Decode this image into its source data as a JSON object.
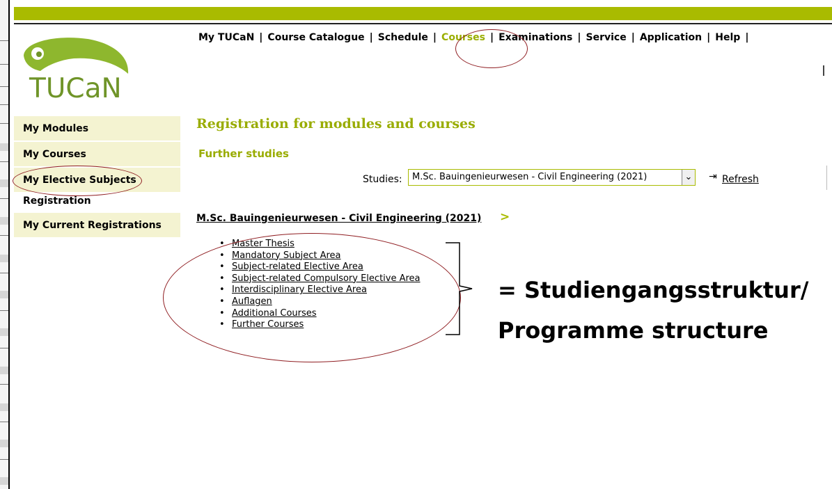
{
  "brand": {
    "logo_text": "TUCaN",
    "logo_icon": "toucan-logo-icon",
    "accent_color": "#a9bb00",
    "logo_color": "#6f9428",
    "highlight_circle_color": "#8f1d21"
  },
  "nav": {
    "items": [
      {
        "label": "My TUCaN"
      },
      {
        "label": "Course Catalogue"
      },
      {
        "label": "Schedule"
      },
      {
        "label": "Courses",
        "active": true
      },
      {
        "label": "Examinations"
      },
      {
        "label": "Service"
      },
      {
        "label": "Application"
      },
      {
        "label": "Help"
      }
    ],
    "separator": "|"
  },
  "sidebar": {
    "items": [
      {
        "label": "My Modules"
      },
      {
        "label": "My Courses"
      },
      {
        "label": "My Elective Subjects"
      },
      {
        "label": "Registration",
        "active": true
      },
      {
        "label": "My Current Registrations"
      }
    ]
  },
  "main": {
    "title": "Registration for modules and courses",
    "subtitle": "Further studies",
    "studies_label": "Studies:",
    "studies_selected": "M.Sc. Bauingenieurwesen - Civil Engineering (2021)",
    "refresh_label": "Refresh",
    "refresh_icon": "arrow-right-icon",
    "program_link": "M.Sc. Bauingenieurwesen - Civil Engineering (2021)",
    "program_arrow": ">",
    "modules": [
      "Master Thesis",
      "Mandatory Subject Area",
      "Subject-related Elective Area",
      "Subject-related Compulsory Elective Area",
      "Interdisciplinary Elective Area",
      "Auflagen",
      "Additional Courses",
      "Further Courses"
    ]
  },
  "annotation": {
    "line1": "= Studiengangsstruktur/",
    "line2": "Programme structure"
  }
}
